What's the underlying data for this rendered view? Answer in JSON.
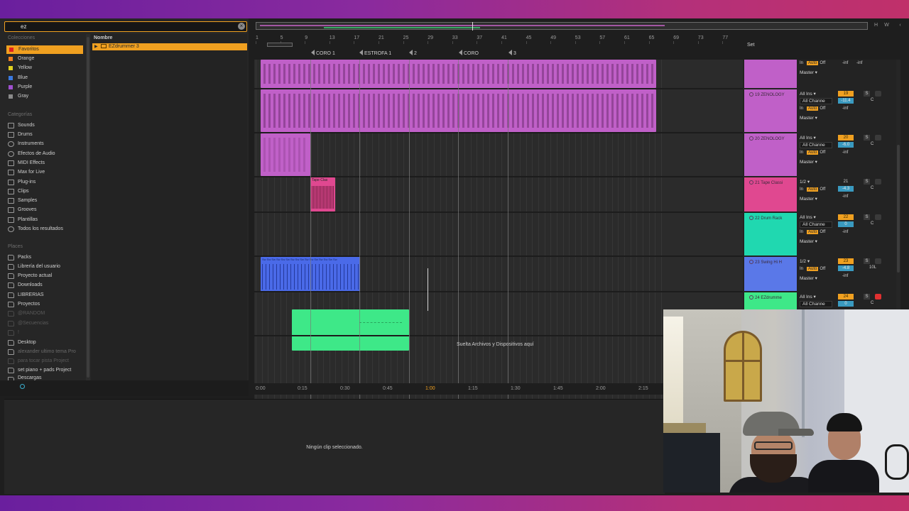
{
  "browser": {
    "search_value": "ez",
    "collections_title": "Colecciones",
    "collections": [
      {
        "label": "Favoritos",
        "color": "#e02020",
        "selected": true
      },
      {
        "label": "Orange",
        "color": "#f08020"
      },
      {
        "label": "Yellow",
        "color": "#e0d020"
      },
      {
        "label": "Blue",
        "color": "#3a7ae0"
      },
      {
        "label": "Purple",
        "color": "#a050d0"
      },
      {
        "label": "Gray",
        "color": "#8a8a8a"
      }
    ],
    "categories_title": "Categorías",
    "categories": [
      "Sounds",
      "Drums",
      "Instruments",
      "Efectos de Audio",
      "MIDI Effects",
      "Max for Live",
      "Plug-ins",
      "Clips",
      "Samples",
      "Grooves",
      "Plantillas",
      "Todos los resultados"
    ],
    "places_title": "Places",
    "places": [
      "Packs",
      "Librería del usuario",
      "Proyecto actual",
      "Downloads",
      "LIBRERIAS",
      "Proyectos",
      "@RANDOM",
      "@Secuencias",
      "!",
      "Desktop",
      "alexander ultimo tema Pro",
      "para tocar pista Project",
      "set piano + pads Project",
      "Descargas"
    ],
    "column_header": "Nombre",
    "result": "EZdrummer 3"
  },
  "arrangement": {
    "bar_numbers": [
      "1",
      "5",
      "9",
      "13",
      "17",
      "21",
      "25",
      "29",
      "33",
      "37",
      "41",
      "45",
      "49",
      "53",
      "57",
      "61",
      "65",
      "69",
      "73",
      "77"
    ],
    "locators": [
      "CORO 1",
      "ESTROFA 1",
      "2",
      "CORO",
      "3"
    ],
    "set_label": "Set",
    "top_buttons": [
      "H",
      "W"
    ],
    "clip_tape_label": "Tape Clas",
    "clip_swing_label": "Sw Sw Sw Sw Sw Sw Sw Sw Sw Sw Sw Sw Sw Sw Sw Sw",
    "drop_text": "Suelta Archivos y Dispositivos aquí",
    "time_labels": [
      "0:00",
      "0:15",
      "0:30",
      "0:45",
      "1:00",
      "1:15",
      "1:30",
      "1:45",
      "2:00",
      "2:15"
    ],
    "colors": {
      "purple": "#c060c8",
      "pink": "#e04890",
      "blue": "#4a6ae8",
      "green": "#3ee888",
      "teal": "#20d8b0"
    }
  },
  "mixer": {
    "tracks": [
      {
        "name": "",
        "input": "",
        "channel": "",
        "output": "Master",
        "num": "",
        "vol": "",
        "inf1": "-inf",
        "inf2": "-inf",
        "color": "#c060c8"
      },
      {
        "name": "19 ZENOLOGY",
        "input": "All Ins",
        "channel": "All Channe",
        "output": "Master",
        "num": "19",
        "vol": "-11.4",
        "pan": "C",
        "inf1": "-inf",
        "color": "#c060c8"
      },
      {
        "name": "20 ZENOLOGY",
        "input": "All Ins",
        "channel": "All Channe",
        "output": "Master",
        "num": "20",
        "vol": "-6.0",
        "pan": "C",
        "inf1": "-inf",
        "color": "#c060c8"
      },
      {
        "name": "21 Tape Classi",
        "input": "1/2",
        "channel": "",
        "output": "Master",
        "num": "21",
        "vol": "-4.3",
        "pan": "C",
        "inf1": "-inf",
        "color": "#e04890"
      },
      {
        "name": "22 Drum Rack",
        "input": "All Ins",
        "channel": "All Channe",
        "output": "Master",
        "num": "22",
        "vol": "0",
        "pan": "C",
        "inf1": "-inf",
        "color": "#20d8b0"
      },
      {
        "name": "23 Swing Hi H",
        "input": "1/2",
        "channel": "",
        "output": "Master",
        "num": "23",
        "vol": "-4.8",
        "pan": "10L",
        "inf1": "-inf",
        "color": "#5a78e8"
      },
      {
        "name": "24 EZdrumme",
        "input": "All Ins",
        "channel": "All Channe",
        "output": "",
        "num": "24",
        "vol": "0",
        "pan": "C",
        "inf1": "",
        "color": "#3ee888"
      }
    ],
    "monitor": {
      "in": "In",
      "auto": "Auto",
      "off": "Off"
    },
    "solo": "S"
  },
  "detail": {
    "message": "Ningún clip seleccionado."
  }
}
